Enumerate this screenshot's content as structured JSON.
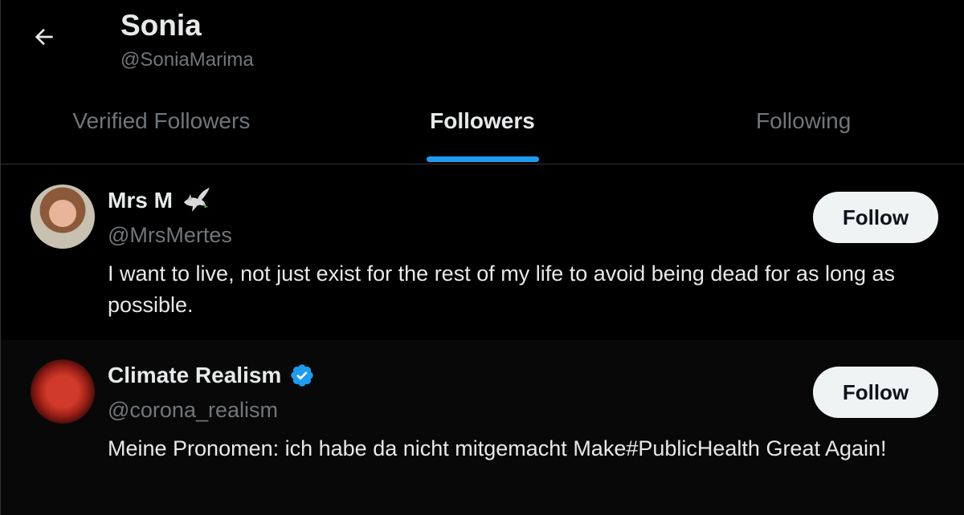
{
  "header": {
    "back_icon": "arrow-left-icon",
    "name": "Sonia",
    "handle": "@SoniaMarima"
  },
  "tabs": [
    {
      "label": "Verified Followers",
      "active": false
    },
    {
      "label": "Followers",
      "active": true
    },
    {
      "label": "Following",
      "active": false
    }
  ],
  "users": [
    {
      "display_name": "Mrs M",
      "name_icon": "dove-icon",
      "username": "@MrsMertes",
      "bio": "I want to live, not just exist for the rest of my life to avoid being dead for as long as possible.",
      "follow_label": "Follow",
      "verified": false
    },
    {
      "display_name": "Climate Realism",
      "name_icon": "verified-badge-icon",
      "username": "@corona_realism",
      "bio": "Meine Pronomen: ich habe da nicht mitgemacht Make#PublicHealth Great Again!",
      "follow_label": "Follow",
      "verified": true
    }
  ],
  "colors": {
    "background": "#000000",
    "accent": "#1d9bf0",
    "muted_text": "#71767b",
    "primary_text": "#e7e9ea",
    "button_bg": "#eff3f4"
  }
}
